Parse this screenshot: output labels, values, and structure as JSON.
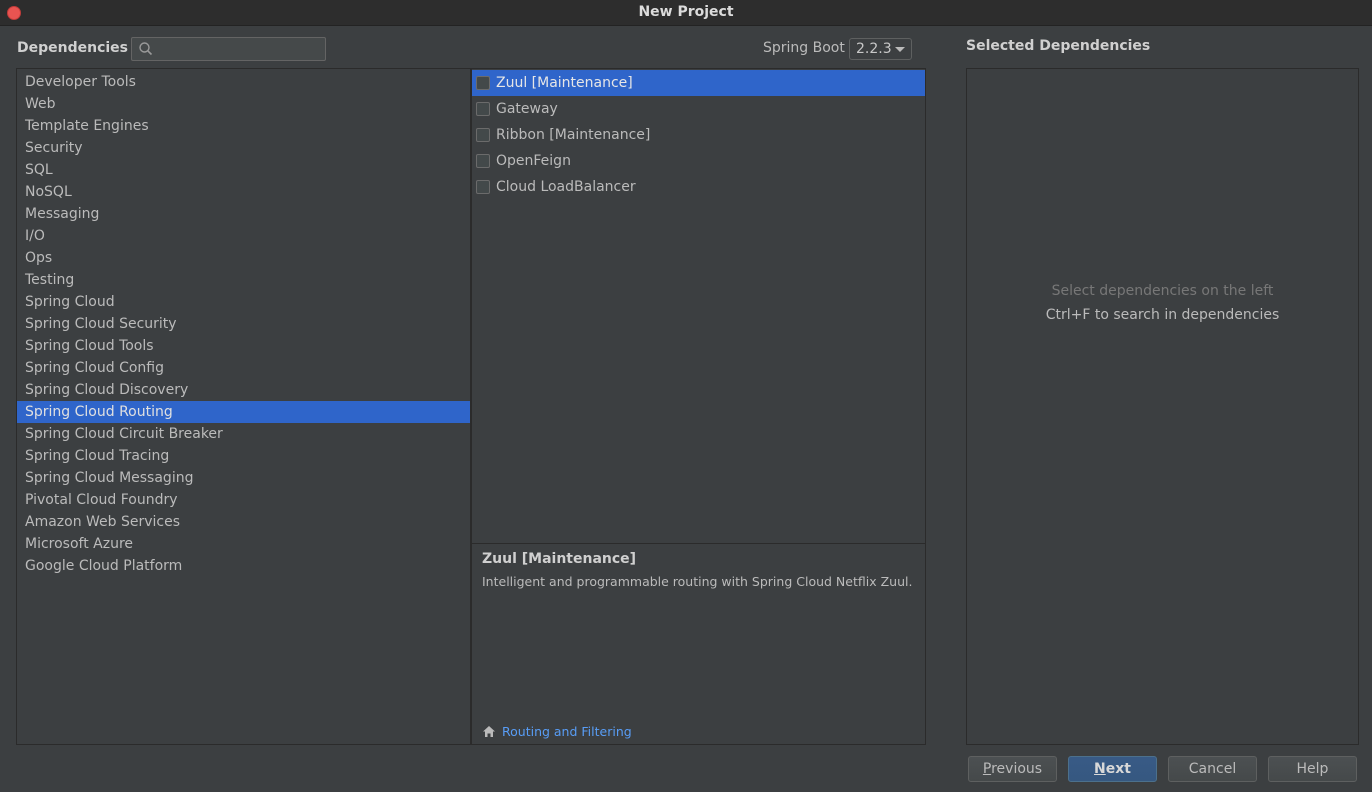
{
  "window": {
    "title": "New Project"
  },
  "header": {
    "dependencies_label": "Dependencies",
    "search_value": "",
    "spring_boot_label": "Spring Boot",
    "spring_boot_version": "2.2.3",
    "selected_dependencies_label": "Selected Dependencies"
  },
  "categories": [
    "Developer Tools",
    "Web",
    "Template Engines",
    "Security",
    "SQL",
    "NoSQL",
    "Messaging",
    "I/O",
    "Ops",
    "Testing",
    "Spring Cloud",
    "Spring Cloud Security",
    "Spring Cloud Tools",
    "Spring Cloud Config",
    "Spring Cloud Discovery",
    "Spring Cloud Routing",
    "Spring Cloud Circuit Breaker",
    "Spring Cloud Tracing",
    "Spring Cloud Messaging",
    "Pivotal Cloud Foundry",
    "Amazon Web Services",
    "Microsoft Azure",
    "Google Cloud Platform"
  ],
  "selected_category_index": 15,
  "dependencies": [
    {
      "label": "Zuul [Maintenance]",
      "checked": false,
      "selected": true
    },
    {
      "label": "Gateway",
      "checked": false,
      "selected": false
    },
    {
      "label": "Ribbon [Maintenance]",
      "checked": false,
      "selected": false
    },
    {
      "label": "OpenFeign",
      "checked": false,
      "selected": false
    },
    {
      "label": "Cloud LoadBalancer",
      "checked": false,
      "selected": false
    }
  ],
  "description": {
    "title": "Zuul [Maintenance]",
    "text": "Intelligent and programmable routing with Spring Cloud Netflix Zuul.",
    "link_label": "Routing and Filtering",
    "link_icon": "home-icon"
  },
  "selected_panel": {
    "hint_primary": "Select dependencies on the left",
    "hint_secondary": "Ctrl+F to search in dependencies"
  },
  "buttons": {
    "previous": {
      "label": "Previous",
      "mnemonic": "P",
      "rest": "revious"
    },
    "next": {
      "label": "Next",
      "mnemonic": "N",
      "rest": "ext"
    },
    "cancel": {
      "label": "Cancel"
    },
    "help": {
      "label": "Help"
    }
  },
  "colors": {
    "background": "#3c3f41",
    "selection": "#2f65ca",
    "link": "#589df6",
    "close_button": "#e95451",
    "default_button": "#365880"
  }
}
